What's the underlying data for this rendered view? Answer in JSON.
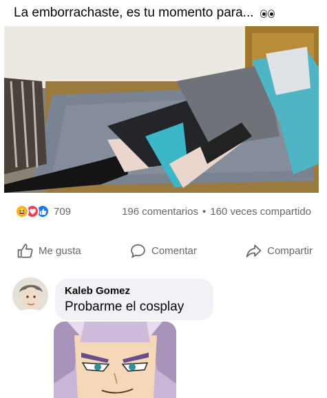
{
  "post": {
    "text": "La emborrachaste, es tu momento para...",
    "emoji_icon": "eyes-emoji-icon"
  },
  "photo": {
    "description_icon": "photo-cosplayer-lying-on-couch"
  },
  "reactions": {
    "count": "709",
    "icons": [
      "haha-reaction-icon",
      "love-reaction-icon",
      "like-reaction-icon"
    ],
    "comments": "196 comentarios",
    "separator": "•",
    "shares": "160 veces compartido"
  },
  "actions": {
    "like": "Me gusta",
    "comment": "Comentar",
    "share": "Compartir"
  },
  "comment": {
    "author": "Kaleb Gomez",
    "text": "Probarme el cosplay"
  },
  "colors": {
    "like_blue": "#1877f2",
    "love_red": "#f33e58",
    "haha_yellow": "#f7b125",
    "bubble_bg": "#f0f2f5",
    "meta_gray": "#65676b"
  }
}
